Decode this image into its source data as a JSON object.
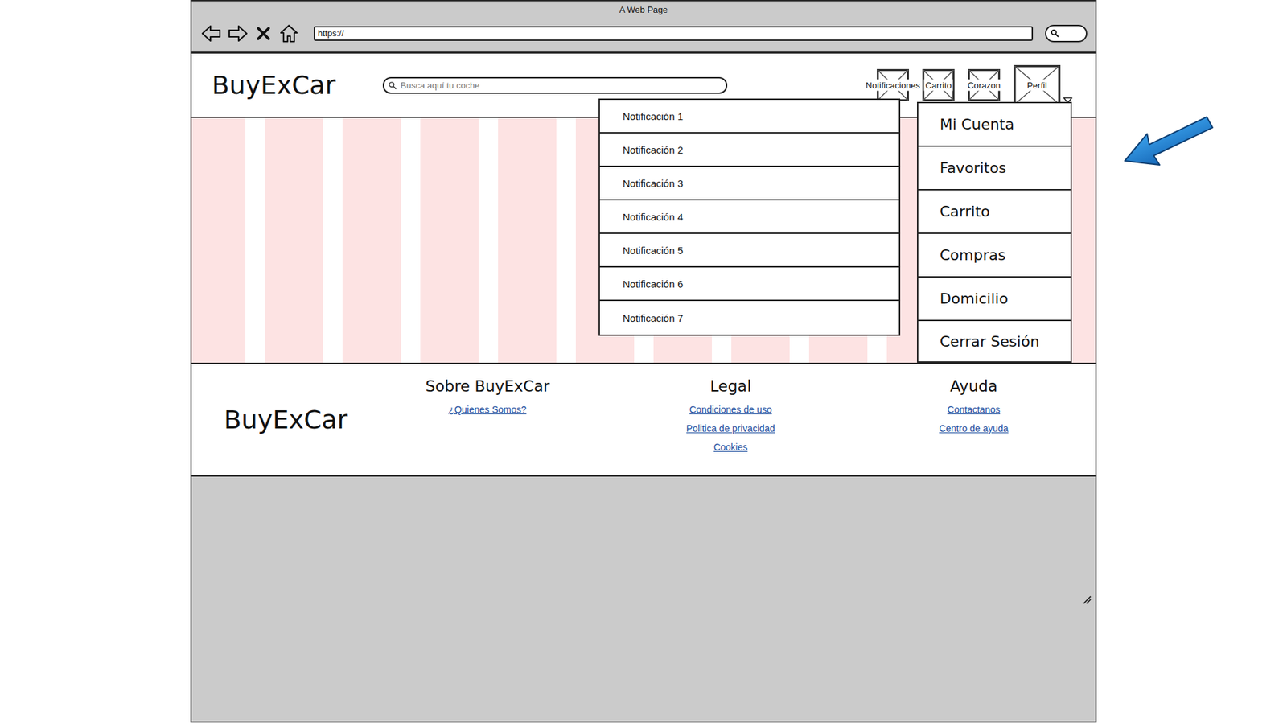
{
  "window": {
    "title": "A Web Page",
    "url": "https://"
  },
  "header": {
    "logo": "BuyExCar",
    "search": {
      "placeholder": "Busca aquí tu coche"
    },
    "icons": [
      {
        "label": "Notificaciones",
        "kind": "icon",
        "expanded": true
      },
      {
        "label": "Carrito",
        "kind": "icon",
        "expanded": false
      },
      {
        "label": "Corazon",
        "kind": "icon",
        "expanded": false
      },
      {
        "label": "Perfil",
        "kind": "profile",
        "expanded": true
      }
    ]
  },
  "notifications": [
    "Notificación 1",
    "Notificación 2",
    "Notificación 3",
    "Notificación 4",
    "Notificación 5",
    "Notificación 6",
    "Notificación 7"
  ],
  "profile_menu": [
    "Mi Cuenta",
    "Favoritos",
    "Carrito",
    "Compras",
    "Domicilio",
    "Cerrar Sesión"
  ],
  "footer": {
    "logo": "BuyExCar",
    "columns": [
      {
        "title": "Sobre BuyExCar",
        "links": [
          "¿Quienes Somos?"
        ]
      },
      {
        "title": "Legal",
        "links": [
          "Condiciones de uso",
          "Politica de privacidad",
          "Cookies"
        ]
      },
      {
        "title": "Ayuda",
        "links": [
          "Contactanos",
          "Centro de ayuda"
        ]
      }
    ]
  }
}
